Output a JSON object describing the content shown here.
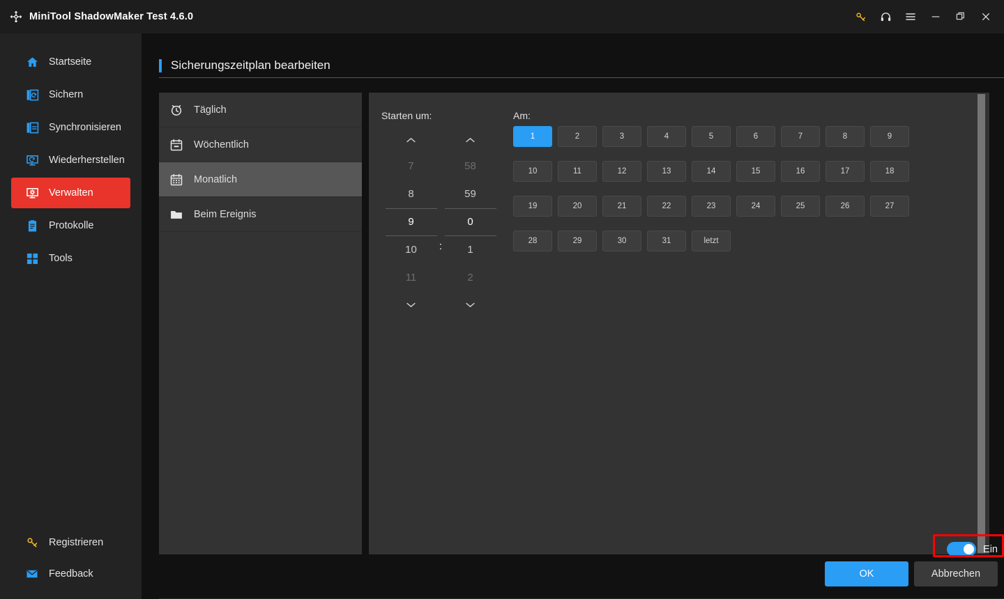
{
  "window": {
    "title": "MiniTool ShadowMaker Test 4.6.0",
    "logo_icon": "refresh-sync-icon",
    "controls": [
      {
        "name": "key-icon",
        "label": "key-icon"
      },
      {
        "name": "headset-icon",
        "label": "headset-icon"
      },
      {
        "name": "menu-icon",
        "label": "menu-icon"
      },
      {
        "name": "minimize-icon",
        "label": "minimize-icon"
      },
      {
        "name": "restore-icon",
        "label": "restore-icon"
      },
      {
        "name": "close-icon",
        "label": "close-icon"
      }
    ]
  },
  "sidebar": {
    "items": [
      {
        "label": "Startseite",
        "icon": "home-icon",
        "active": false
      },
      {
        "label": "Sichern",
        "icon": "backup-icon",
        "active": false
      },
      {
        "label": "Synchronisieren",
        "icon": "sync-icon",
        "active": false
      },
      {
        "label": "Wiederherstellen",
        "icon": "restore-disk-icon",
        "active": false
      },
      {
        "label": "Verwalten",
        "icon": "manage-icon",
        "active": true
      },
      {
        "label": "Protokolle",
        "icon": "log-icon",
        "active": false
      },
      {
        "label": "Tools",
        "icon": "tools-icon",
        "active": false
      }
    ],
    "bottom_items": [
      {
        "label": "Registrieren",
        "icon": "key-icon"
      },
      {
        "label": "Feedback",
        "icon": "mail-icon"
      }
    ]
  },
  "page": {
    "title": "Sicherungszeitplan bearbeiten"
  },
  "schedule_types": [
    {
      "label": "Täglich",
      "icon": "alarm-clock-icon",
      "selected": false
    },
    {
      "label": "Wöchentlich",
      "icon": "calendar-week-icon",
      "selected": false
    },
    {
      "label": "Monatlich",
      "icon": "calendar-month-icon",
      "selected": true
    },
    {
      "label": "Beim Ereignis",
      "icon": "folder-icon",
      "selected": false
    }
  ],
  "time_picker": {
    "label": "Starten um:",
    "separator": ":",
    "hours": [
      {
        "value": "7",
        "state": "dim"
      },
      {
        "value": "8",
        "state": "normal"
      },
      {
        "value": "9",
        "state": "selected"
      },
      {
        "value": "10",
        "state": "normal"
      },
      {
        "value": "11",
        "state": "dim"
      }
    ],
    "minutes": [
      {
        "value": "58",
        "state": "dim"
      },
      {
        "value": "59",
        "state": "normal"
      },
      {
        "value": "0",
        "state": "selected"
      },
      {
        "value": "1",
        "state": "normal"
      },
      {
        "value": "2",
        "state": "dim"
      }
    ],
    "selected_hour": "9",
    "selected_minute": "0"
  },
  "day_grid": {
    "label": "Am:",
    "rows": [
      [
        {
          "label": "1",
          "selected": false
        },
        {
          "label": "2",
          "selected": false
        },
        {
          "label": "3",
          "selected": false
        },
        {
          "label": "4",
          "selected": false
        },
        {
          "label": "5",
          "selected": true
        },
        {
          "label": "6",
          "selected": false
        },
        {
          "label": "7",
          "selected": false
        },
        {
          "label": "8",
          "selected": false
        },
        {
          "label": "9",
          "selected": false
        }
      ],
      [
        {
          "label": "10",
          "selected": false
        },
        {
          "label": "11",
          "selected": false
        },
        {
          "label": "12",
          "selected": false
        },
        {
          "label": "13",
          "selected": false
        },
        {
          "label": "14",
          "selected": false
        },
        {
          "label": "15",
          "selected": true
        },
        {
          "label": "16",
          "selected": false
        },
        {
          "label": "17",
          "selected": false
        },
        {
          "label": "18",
          "selected": false
        }
      ],
      [
        {
          "label": "19",
          "selected": false
        },
        {
          "label": "20",
          "selected": false
        },
        {
          "label": "21",
          "selected": false
        },
        {
          "label": "22",
          "selected": false
        },
        {
          "label": "23",
          "selected": false
        },
        {
          "label": "24",
          "selected": false
        },
        {
          "label": "25",
          "selected": true
        },
        {
          "label": "26",
          "selected": false
        },
        {
          "label": "27",
          "selected": false
        }
      ],
      [
        {
          "label": "28",
          "selected": false
        },
        {
          "label": "29",
          "selected": false
        },
        {
          "label": "30",
          "selected": false
        },
        {
          "label": "31",
          "selected": false
        },
        {
          "label": "letzt",
          "selected": false
        }
      ]
    ]
  },
  "footer": {
    "toggle_label": "Ein",
    "toggle_on": true,
    "ok_label": "OK",
    "cancel_label": "Abbrechen"
  },
  "colors": {
    "accent_blue": "#2a9df4",
    "active_red": "#e8342a",
    "panel": "#333333",
    "window_bg": "#111111",
    "sidebar": "#232323",
    "highlight_box": "#ff0000",
    "key_gold": "#f0b323"
  }
}
